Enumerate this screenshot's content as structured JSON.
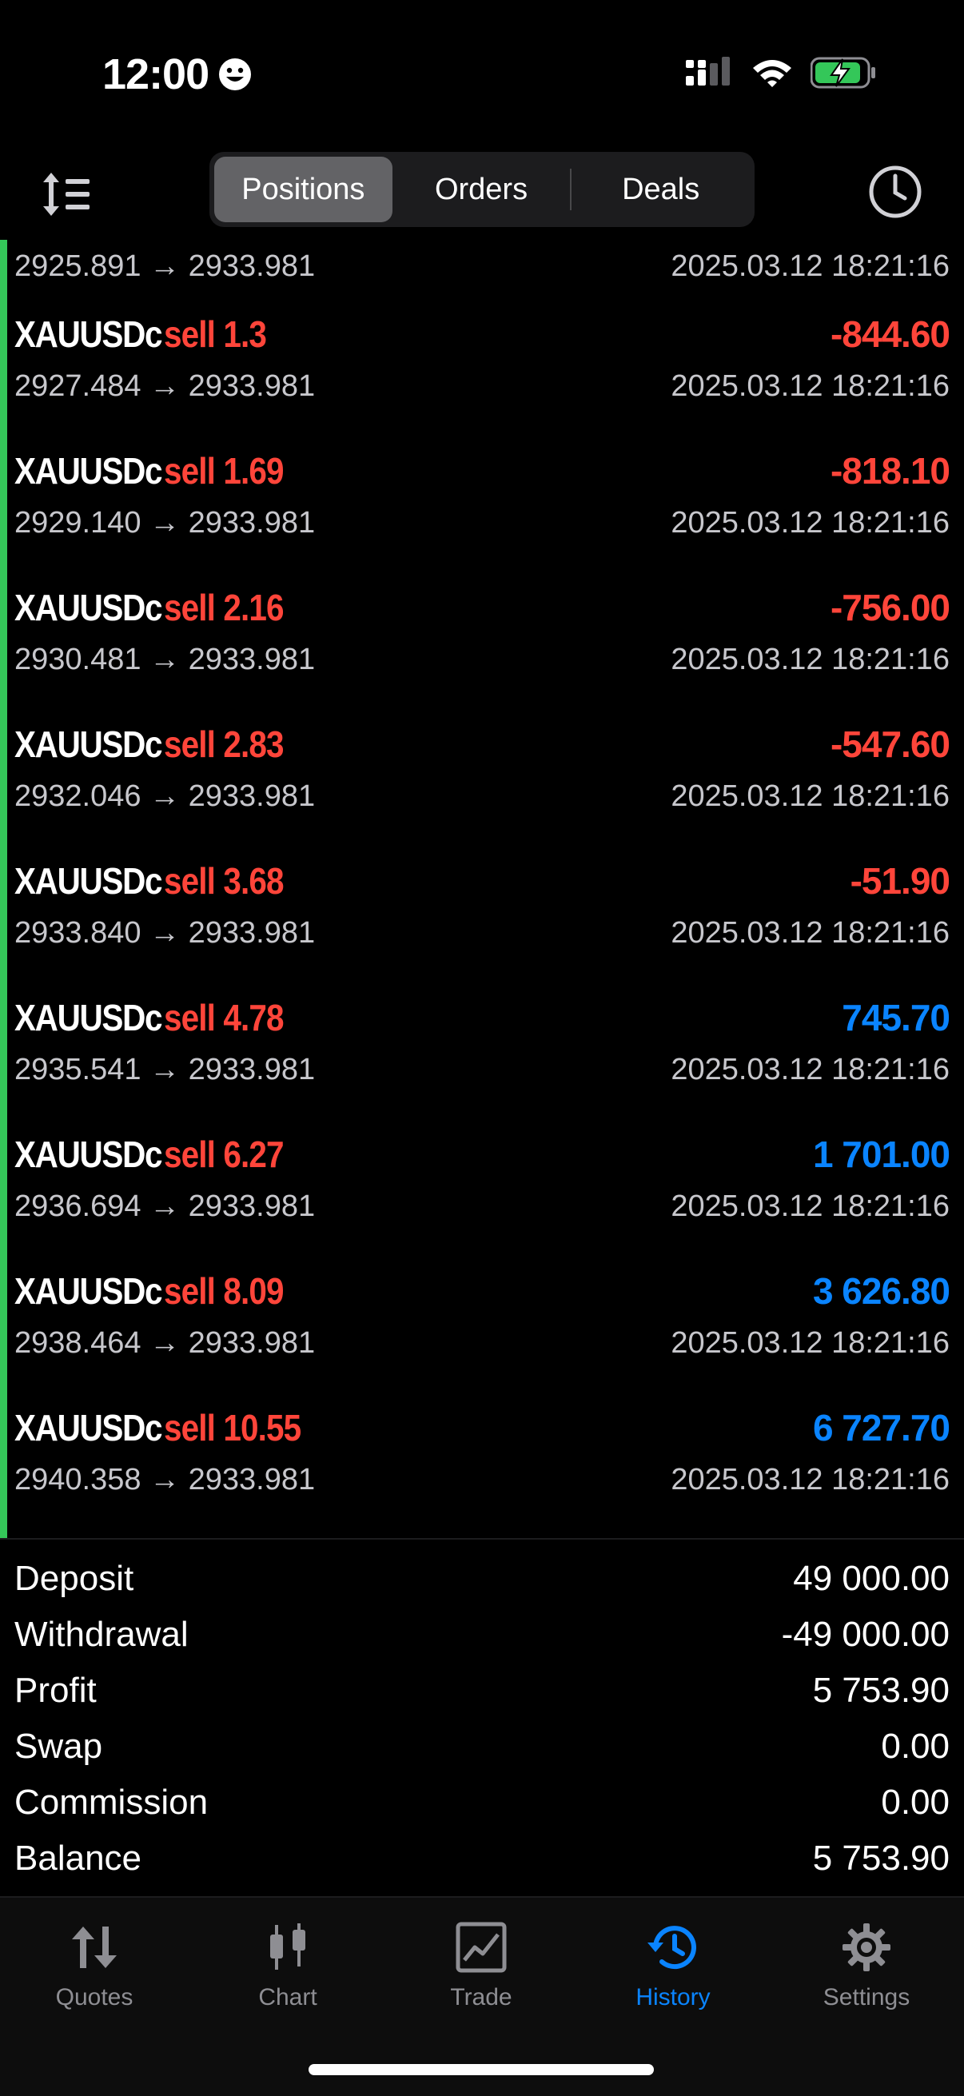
{
  "status_bar": {
    "time": "12:00"
  },
  "header": {
    "segments": [
      {
        "label": "Positions",
        "active": true
      },
      {
        "label": "Orders",
        "active": false
      },
      {
        "label": "Deals",
        "active": false
      }
    ]
  },
  "partial_row": {
    "prices": "2925.891 → 2933.981",
    "datetime": "2025.03.12 18:21:16"
  },
  "positions": [
    {
      "symbol": "XAUUSDc",
      "side": "sell 1.3",
      "profit": "-844.60",
      "prices": "2927.484 → 2933.981",
      "datetime": "2025.03.12 18:21:16"
    },
    {
      "symbol": "XAUUSDc",
      "side": "sell 1.69",
      "profit": "-818.10",
      "prices": "2929.140 → 2933.981",
      "datetime": "2025.03.12 18:21:16"
    },
    {
      "symbol": "XAUUSDc",
      "side": "sell 2.16",
      "profit": "-756.00",
      "prices": "2930.481 → 2933.981",
      "datetime": "2025.03.12 18:21:16"
    },
    {
      "symbol": "XAUUSDc",
      "side": "sell 2.83",
      "profit": "-547.60",
      "prices": "2932.046 → 2933.981",
      "datetime": "2025.03.12 18:21:16"
    },
    {
      "symbol": "XAUUSDc",
      "side": "sell 3.68",
      "profit": "-51.90",
      "prices": "2933.840 → 2933.981",
      "datetime": "2025.03.12 18:21:16"
    },
    {
      "symbol": "XAUUSDc",
      "side": "sell 4.78",
      "profit": "745.70",
      "prices": "2935.541 → 2933.981",
      "datetime": "2025.03.12 18:21:16"
    },
    {
      "symbol": "XAUUSDc",
      "side": "sell 6.27",
      "profit": "1 701.00",
      "prices": "2936.694 → 2933.981",
      "datetime": "2025.03.12 18:21:16"
    },
    {
      "symbol": "XAUUSDc",
      "side": "sell 8.09",
      "profit": "3 626.80",
      "prices": "2938.464 → 2933.981",
      "datetime": "2025.03.12 18:21:16"
    },
    {
      "symbol": "XAUUSDc",
      "side": "sell 10.55",
      "profit": "6 727.70",
      "prices": "2940.358 → 2933.981",
      "datetime": "2025.03.12 18:21:16"
    }
  ],
  "summary": [
    {
      "label": "Deposit",
      "value": "49 000.00"
    },
    {
      "label": "Withdrawal",
      "value": "-49 000.00"
    },
    {
      "label": "Profit",
      "value": "5 753.90"
    },
    {
      "label": "Swap",
      "value": "0.00"
    },
    {
      "label": "Commission",
      "value": "0.00"
    },
    {
      "label": "Balance",
      "value": "5 753.90"
    }
  ],
  "tabbar": {
    "tabs": [
      {
        "label": "Quotes",
        "icon": "quotes-icon",
        "active": false
      },
      {
        "label": "Chart",
        "icon": "chart-icon",
        "active": false
      },
      {
        "label": "Trade",
        "icon": "trade-icon",
        "active": false
      },
      {
        "label": "History",
        "icon": "history-icon",
        "active": true
      },
      {
        "label": "Settings",
        "icon": "gear-icon",
        "active": false
      }
    ]
  },
  "colors": {
    "negative": "#ff453a",
    "positive": "#0a84ff",
    "accent_bar": "#34c759",
    "active_tab": "#0a84ff"
  }
}
